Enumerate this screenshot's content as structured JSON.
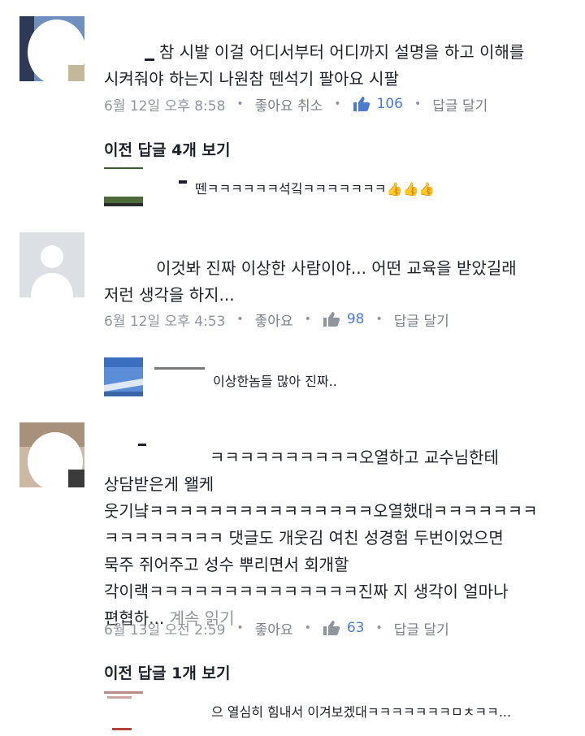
{
  "comments": [
    {
      "text_line1": "참 시발 이걸 어디서부터 어디까지 설명을 하고 이해를",
      "text_line2": "시켜줘야 하는지 나원참 뗀석기 팔아요 시팔",
      "time": "6월 12일 오후 8:58",
      "like_label": "좋아요 취소",
      "like_count": "106",
      "reply_label": "답글 달기",
      "prev_replies": "이전 답글 4개 보기",
      "reply_text": "뗀ㅋㅋㅋㅋㅋㅋ석깈ㅋㅋㅋㅋㅋㅋㅋ👍👍👍"
    },
    {
      "text_line1": "이것봐 진짜 이상한 사람이야... 어떤 교육을 받았길래",
      "text_line2": "저런 생각을 하지...",
      "time": "6월 12일 오후 4:53",
      "like_label": "좋아요",
      "like_count": "98",
      "reply_label": "답글 달기",
      "reply_text": "이상한놈들 많아 진짜.."
    },
    {
      "text_line1": "ㅋㅋㅋㅋㅋㅋㅋㅋㅋㅋ오열하고 교수님한테",
      "text_line2": "상담받은게 왤케",
      "text_line3": "웃기냨ㅋㅋㅋㅋㅋㅋㅋㅋㅋㅋㅋㅋㅋㅋㅋ오열했대ㅋㅋㅋㅋㅋㅋㅋ",
      "text_line4": "ㅋㅋㅋㅋㅋㅋㅋㅋ 댓글도 개웃김 여친 성경험 두번이었으면",
      "text_line5": "묵주 쥐어주고 성수 뿌리면서 회개할",
      "text_line6": "각이랙ㅋㅋㅋㅋㅋㅋㅋㅋㅋㅋㅋㅋㅋㅋ진짜 지 생각이 얼마나",
      "text_line7": "편협하...",
      "more_label": "계속 읽기",
      "time": "6월 13일 오전 2:59",
      "like_label": "좋아요",
      "like_count": "63",
      "reply_label": "답글 달기",
      "prev_replies": "이전 답글 1개 보기",
      "reply_text": "으 열심히 힘내서 이겨보겠대ㅋㅋㅋㅋㅋㅋㅋㅁㅊㅋㅋ..."
    }
  ],
  "colors": {
    "meta": "#90949c",
    "count": "#4b7bd0",
    "text": "#1d2129"
  }
}
